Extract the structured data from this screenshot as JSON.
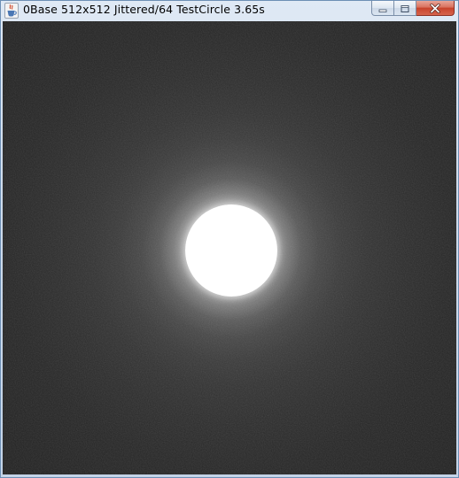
{
  "window": {
    "title": "0Base 512x512 Jittered/64  TestCircle 3.65s",
    "app_icon": "java-coffee-cup-icon",
    "buttons": {
      "minimize_icon": "minimize-icon",
      "maximize_icon": "maximize-icon",
      "close_icon": "close-icon"
    }
  },
  "render": {
    "scene": "TestCircle",
    "background_color": "#141414",
    "glow_color": "#d0d0d0",
    "object_color": "#ffffff"
  },
  "colors": {
    "titlebar_top": "#dfe9f5",
    "titlebar_bottom": "#c4d4e8",
    "close_button": "#c7432b",
    "border": "#6d8fb5"
  }
}
